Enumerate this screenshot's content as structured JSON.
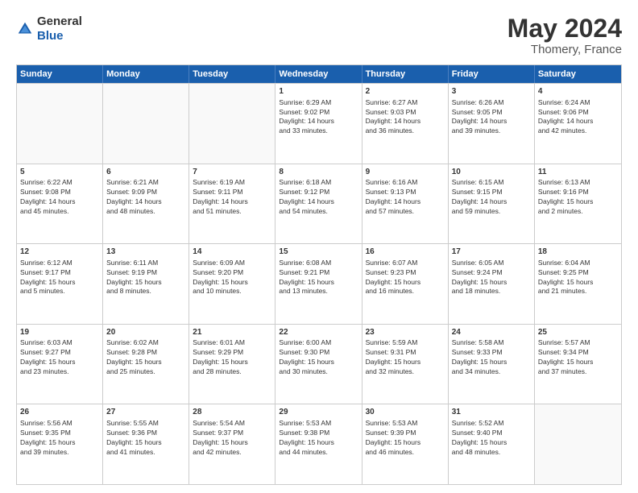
{
  "logo": {
    "general": "General",
    "blue": "Blue"
  },
  "title": {
    "month_year": "May 2024",
    "location": "Thomery, France"
  },
  "header": {
    "days": [
      "Sunday",
      "Monday",
      "Tuesday",
      "Wednesday",
      "Thursday",
      "Friday",
      "Saturday"
    ]
  },
  "weeks": [
    [
      {
        "day": "",
        "empty": true,
        "lines": []
      },
      {
        "day": "",
        "empty": true,
        "lines": []
      },
      {
        "day": "",
        "empty": true,
        "lines": []
      },
      {
        "day": "1",
        "lines": [
          "Sunrise: 6:29 AM",
          "Sunset: 9:02 PM",
          "Daylight: 14 hours",
          "and 33 minutes."
        ]
      },
      {
        "day": "2",
        "lines": [
          "Sunrise: 6:27 AM",
          "Sunset: 9:03 PM",
          "Daylight: 14 hours",
          "and 36 minutes."
        ]
      },
      {
        "day": "3",
        "lines": [
          "Sunrise: 6:26 AM",
          "Sunset: 9:05 PM",
          "Daylight: 14 hours",
          "and 39 minutes."
        ]
      },
      {
        "day": "4",
        "lines": [
          "Sunrise: 6:24 AM",
          "Sunset: 9:06 PM",
          "Daylight: 14 hours",
          "and 42 minutes."
        ]
      }
    ],
    [
      {
        "day": "5",
        "lines": [
          "Sunrise: 6:22 AM",
          "Sunset: 9:08 PM",
          "Daylight: 14 hours",
          "and 45 minutes."
        ]
      },
      {
        "day": "6",
        "lines": [
          "Sunrise: 6:21 AM",
          "Sunset: 9:09 PM",
          "Daylight: 14 hours",
          "and 48 minutes."
        ]
      },
      {
        "day": "7",
        "lines": [
          "Sunrise: 6:19 AM",
          "Sunset: 9:11 PM",
          "Daylight: 14 hours",
          "and 51 minutes."
        ]
      },
      {
        "day": "8",
        "lines": [
          "Sunrise: 6:18 AM",
          "Sunset: 9:12 PM",
          "Daylight: 14 hours",
          "and 54 minutes."
        ]
      },
      {
        "day": "9",
        "lines": [
          "Sunrise: 6:16 AM",
          "Sunset: 9:13 PM",
          "Daylight: 14 hours",
          "and 57 minutes."
        ]
      },
      {
        "day": "10",
        "lines": [
          "Sunrise: 6:15 AM",
          "Sunset: 9:15 PM",
          "Daylight: 14 hours",
          "and 59 minutes."
        ]
      },
      {
        "day": "11",
        "lines": [
          "Sunrise: 6:13 AM",
          "Sunset: 9:16 PM",
          "Daylight: 15 hours",
          "and 2 minutes."
        ]
      }
    ],
    [
      {
        "day": "12",
        "lines": [
          "Sunrise: 6:12 AM",
          "Sunset: 9:17 PM",
          "Daylight: 15 hours",
          "and 5 minutes."
        ]
      },
      {
        "day": "13",
        "lines": [
          "Sunrise: 6:11 AM",
          "Sunset: 9:19 PM",
          "Daylight: 15 hours",
          "and 8 minutes."
        ]
      },
      {
        "day": "14",
        "lines": [
          "Sunrise: 6:09 AM",
          "Sunset: 9:20 PM",
          "Daylight: 15 hours",
          "and 10 minutes."
        ]
      },
      {
        "day": "15",
        "lines": [
          "Sunrise: 6:08 AM",
          "Sunset: 9:21 PM",
          "Daylight: 15 hours",
          "and 13 minutes."
        ]
      },
      {
        "day": "16",
        "lines": [
          "Sunrise: 6:07 AM",
          "Sunset: 9:23 PM",
          "Daylight: 15 hours",
          "and 16 minutes."
        ]
      },
      {
        "day": "17",
        "lines": [
          "Sunrise: 6:05 AM",
          "Sunset: 9:24 PM",
          "Daylight: 15 hours",
          "and 18 minutes."
        ]
      },
      {
        "day": "18",
        "lines": [
          "Sunrise: 6:04 AM",
          "Sunset: 9:25 PM",
          "Daylight: 15 hours",
          "and 21 minutes."
        ]
      }
    ],
    [
      {
        "day": "19",
        "lines": [
          "Sunrise: 6:03 AM",
          "Sunset: 9:27 PM",
          "Daylight: 15 hours",
          "and 23 minutes."
        ]
      },
      {
        "day": "20",
        "lines": [
          "Sunrise: 6:02 AM",
          "Sunset: 9:28 PM",
          "Daylight: 15 hours",
          "and 25 minutes."
        ]
      },
      {
        "day": "21",
        "lines": [
          "Sunrise: 6:01 AM",
          "Sunset: 9:29 PM",
          "Daylight: 15 hours",
          "and 28 minutes."
        ]
      },
      {
        "day": "22",
        "lines": [
          "Sunrise: 6:00 AM",
          "Sunset: 9:30 PM",
          "Daylight: 15 hours",
          "and 30 minutes."
        ]
      },
      {
        "day": "23",
        "lines": [
          "Sunrise: 5:59 AM",
          "Sunset: 9:31 PM",
          "Daylight: 15 hours",
          "and 32 minutes."
        ]
      },
      {
        "day": "24",
        "lines": [
          "Sunrise: 5:58 AM",
          "Sunset: 9:33 PM",
          "Daylight: 15 hours",
          "and 34 minutes."
        ]
      },
      {
        "day": "25",
        "lines": [
          "Sunrise: 5:57 AM",
          "Sunset: 9:34 PM",
          "Daylight: 15 hours",
          "and 37 minutes."
        ]
      }
    ],
    [
      {
        "day": "26",
        "lines": [
          "Sunrise: 5:56 AM",
          "Sunset: 9:35 PM",
          "Daylight: 15 hours",
          "and 39 minutes."
        ]
      },
      {
        "day": "27",
        "lines": [
          "Sunrise: 5:55 AM",
          "Sunset: 9:36 PM",
          "Daylight: 15 hours",
          "and 41 minutes."
        ]
      },
      {
        "day": "28",
        "lines": [
          "Sunrise: 5:54 AM",
          "Sunset: 9:37 PM",
          "Daylight: 15 hours",
          "and 42 minutes."
        ]
      },
      {
        "day": "29",
        "lines": [
          "Sunrise: 5:53 AM",
          "Sunset: 9:38 PM",
          "Daylight: 15 hours",
          "and 44 minutes."
        ]
      },
      {
        "day": "30",
        "lines": [
          "Sunrise: 5:53 AM",
          "Sunset: 9:39 PM",
          "Daylight: 15 hours",
          "and 46 minutes."
        ]
      },
      {
        "day": "31",
        "lines": [
          "Sunrise: 5:52 AM",
          "Sunset: 9:40 PM",
          "Daylight: 15 hours",
          "and 48 minutes."
        ]
      },
      {
        "day": "",
        "empty": true,
        "lines": []
      }
    ]
  ]
}
